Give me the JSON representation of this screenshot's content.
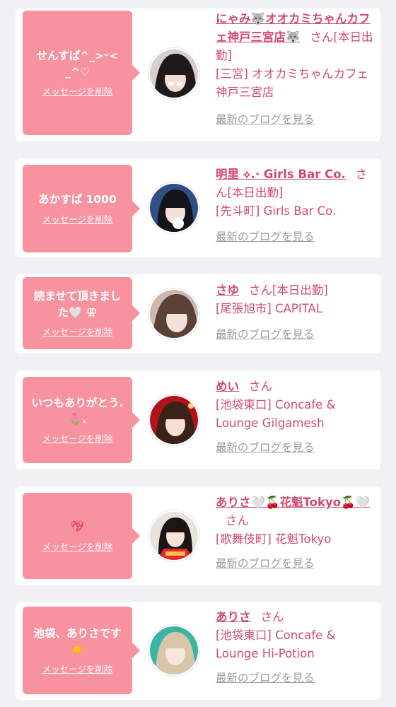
{
  "cards": [
    {
      "message": "せんすぱ^_>ᵕ<\n_^♡",
      "delete_label": "メッセージを削除",
      "name": "にゃみ🐺オオカミちゃんカフェ神戸三宮店🐺",
      "suffix": "さん",
      "status": "[本日出勤]",
      "shop": "[三宮] オオカミちゃんカフェ神戸三宮店",
      "blog_label": "最新のブログを見る"
    },
    {
      "message": "あかすぱ 1000",
      "delete_label": "メッセージを削除",
      "name": "明里 ⟡.· Girls Bar Co.",
      "suffix": "さん",
      "status": "[本日出勤]",
      "shop": "[先斗町] Girls Bar Co.",
      "blog_label": "最新のブログを見る"
    },
    {
      "message": "読ませて頂きました🤍 ⚢",
      "delete_label": "メッセージを削除",
      "name": "さゆ",
      "suffix": "さん",
      "status": "[本日出勤]",
      "shop": "[尾張旭市] CAPITAL",
      "blog_label": "最新のブログを見る"
    },
    {
      "message": "いつもありがとう.🌷.",
      "delete_label": "メッセージを削除",
      "name": "めい",
      "suffix": "さん",
      "status": "",
      "shop": "[池袋東口] Concafe & Lounge Gilgamesh",
      "blog_label": "最新のブログを見る"
    },
    {
      "message": "💖",
      "delete_label": "メッセージを削除",
      "name": "ありさ🤍🍒花魁Tokyo🍒🤍",
      "suffix": "さん",
      "status": "",
      "shop": "[歌舞伎町] 花魁Tokyo",
      "blog_label": "最新のブログを見る"
    },
    {
      "message": "池袋、ありさです☀️",
      "delete_label": "メッセージを削除",
      "name": "ありさ",
      "suffix": "さん",
      "status": "",
      "shop": "[池袋東口] Concafe & Lounge Hi-Potion",
      "blog_label": "最新のブログを見る"
    }
  ],
  "colors": {
    "accent_pink": "#f7929f",
    "name_text": "#d04a6f",
    "link_gray": "#9b9b9b",
    "background": "#f1f1f3"
  }
}
